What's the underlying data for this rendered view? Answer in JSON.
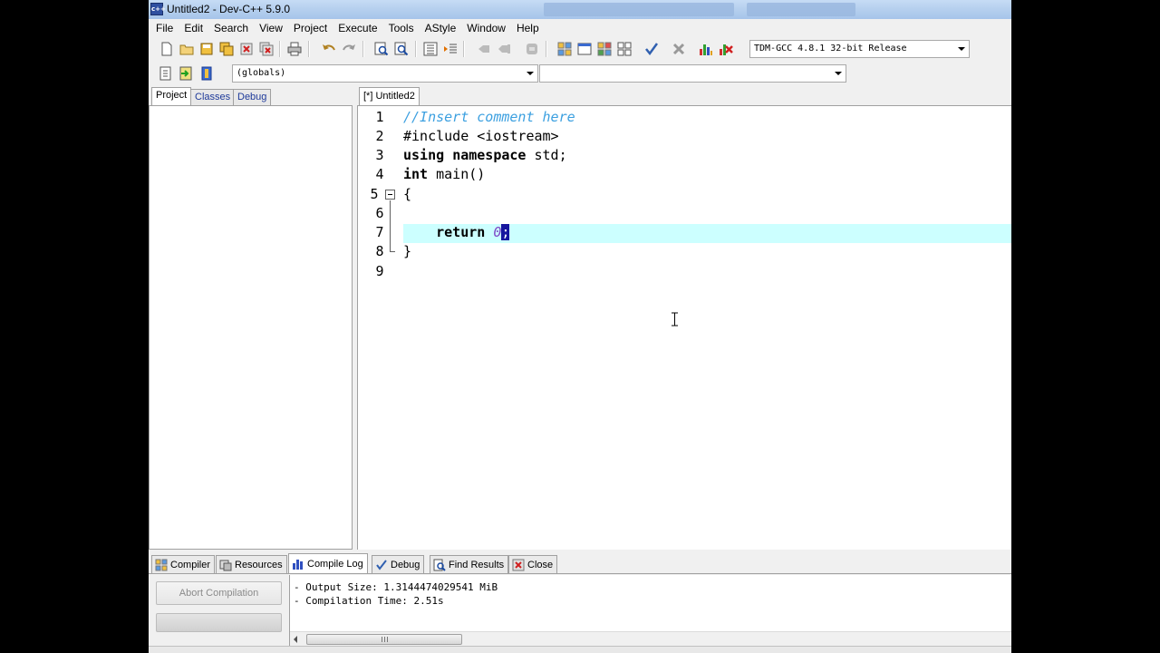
{
  "window": {
    "title": "Untitled2 - Dev-C++ 5.9.0",
    "app_icon_label": "c++"
  },
  "menu": [
    "File",
    "Edit",
    "Search",
    "View",
    "Project",
    "Execute",
    "Tools",
    "AStyle",
    "Window",
    "Help"
  ],
  "toolbar": {
    "compiler_select": "TDM-GCC 4.8.1 32-bit Release",
    "scope_select": "(globals)",
    "member_select": ""
  },
  "left_tabs": [
    "Project",
    "Classes",
    "Debug"
  ],
  "editor": {
    "tab_label": "[*] Untitled2",
    "line_numbers": [
      "1",
      "2",
      "3",
      "4",
      "5",
      "6",
      "7",
      "8",
      "9"
    ],
    "code": {
      "l1": "//Insert comment here",
      "l2": "#include <iostream>",
      "l3_kw1": "using",
      "l3_kw2": "namespace",
      "l3_rest": " std;",
      "l4_kw": "int",
      "l4_rest": " main()",
      "l5": "{",
      "l7_kw": "return",
      "l7_num": "0",
      "l7_sel": ";",
      "l8": "}"
    },
    "current_line": 7
  },
  "bottom_tabs": [
    "Compiler",
    "Resources",
    "Compile Log",
    "Debug",
    "Find Results",
    "Close"
  ],
  "compile_log": {
    "abort_label": "Abort Compilation",
    "lines": [
      "- Output Size: 1.3144474029541 MiB",
      "- Compilation Time: 2.51s"
    ]
  }
}
